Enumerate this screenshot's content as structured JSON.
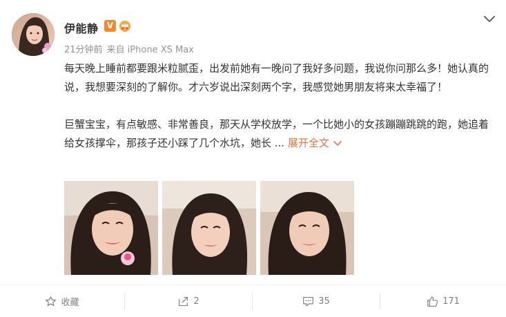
{
  "post": {
    "author": "伊能静",
    "verified_badge": "V",
    "time": "21分钟前",
    "source": "来自 iPhone XS Max",
    "paragraph1": "每天晚上睡前都要跟米粒腻歪，出发前她有一晚问了我好多问题，我说你问那么多！她认真的说，我想要深刻的了解你。才六岁说出深刻两个字，我感觉她男朋友将来太幸福了！",
    "paragraph2": "巨蟹宝宝，有点敏感、非常善良，那天从学校放学，一个比她小的女孩蹦蹦跳跳的跑，她追着给女孩撑伞，那孩子还小踩了几个水坑，她长 ...",
    "expand_label": "展开全文",
    "photo_count": 3
  },
  "actions": {
    "favorite_label": "收藏",
    "repost_count": "2",
    "comment_count": "35",
    "like_count": "171"
  },
  "icons": {
    "menu": "chevron-down-icon",
    "member": "member-crown-icon",
    "favorite": "star-icon",
    "repost": "share-icon",
    "comment": "comment-icon",
    "like": "thumbs-up-icon"
  },
  "colors": {
    "text": "#333333",
    "meta": "#939393",
    "accent": "#eb7340",
    "verified": "#f6882c",
    "action": "#808080"
  }
}
